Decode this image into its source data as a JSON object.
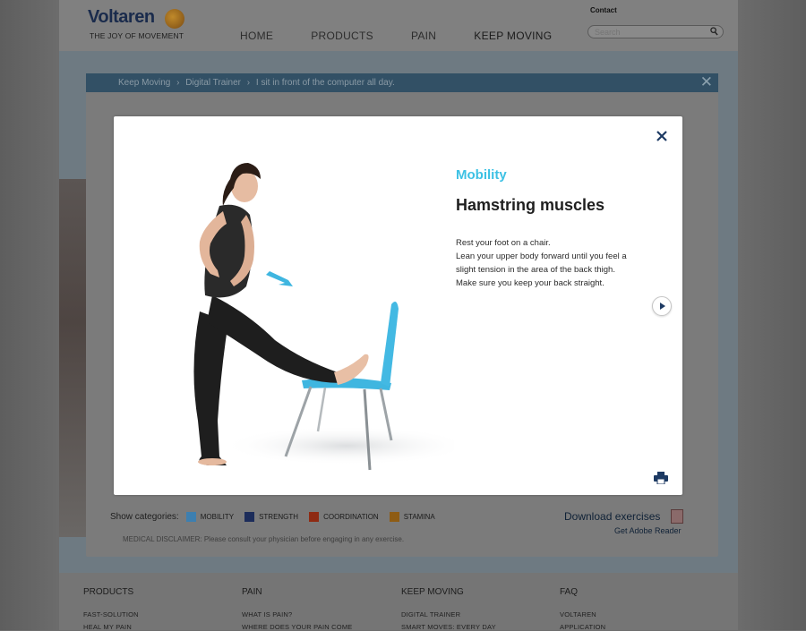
{
  "colors": {
    "accent": "#3dc1e4",
    "mobility": "#3d7fb0",
    "strength": "#1c2c5a",
    "coordination": "#8e2a12",
    "stamina": "#8e5c14"
  },
  "header": {
    "logo_word": "Voltaren",
    "logo_tagline": "THE JOY OF MOVEMENT",
    "nav": [
      "HOME",
      "PRODUCTS",
      "PAIN",
      "KEEP MOVING"
    ],
    "contact": "Contact",
    "search_placeholder": "Search"
  },
  "breadcrumb": {
    "items": [
      "Keep Moving",
      "Digital Trainer",
      "I sit in front of the computer all day."
    ],
    "separator": "›"
  },
  "modal": {
    "category": "Mobility",
    "title": "Hamstring muscles",
    "description": [
      "Rest your foot on a chair.",
      "Lean your upper body forward until you feel a",
      "slight tension in the area of the back thigh.",
      "Make sure you keep your back straight."
    ],
    "icons": [
      "close-icon",
      "next-arrow-icon",
      "print-icon"
    ]
  },
  "categories": {
    "label": "Show categories:",
    "items": [
      {
        "label": "MOBILITY",
        "checked": true
      },
      {
        "label": "STRENGTH",
        "checked": false
      },
      {
        "label": "COORDINATION",
        "checked": false
      },
      {
        "label": "STAMINA",
        "checked": false
      }
    ]
  },
  "downloads": {
    "download_label": "Download exercises",
    "adobe_label": "Get Adobe Reader"
  },
  "disclaimer": "MEDICAL DISCLAIMER: Please consult your physician before engaging in any exercise.",
  "footer": {
    "columns": [
      {
        "title": "PRODUCTS",
        "links": [
          "FAST-SOLUTION",
          "HEAL MY PAIN"
        ]
      },
      {
        "title": "PAIN",
        "links": [
          "WHAT IS PAIN?",
          "WHERE DOES YOUR PAIN COME"
        ]
      },
      {
        "title": "KEEP MOVING",
        "links": [
          "DIGITAL TRAINER",
          "SMART MOVES: EVERY DAY"
        ]
      },
      {
        "title": "FAQ",
        "links": [
          "VOLTAREN",
          "APPLICATION"
        ]
      }
    ]
  }
}
